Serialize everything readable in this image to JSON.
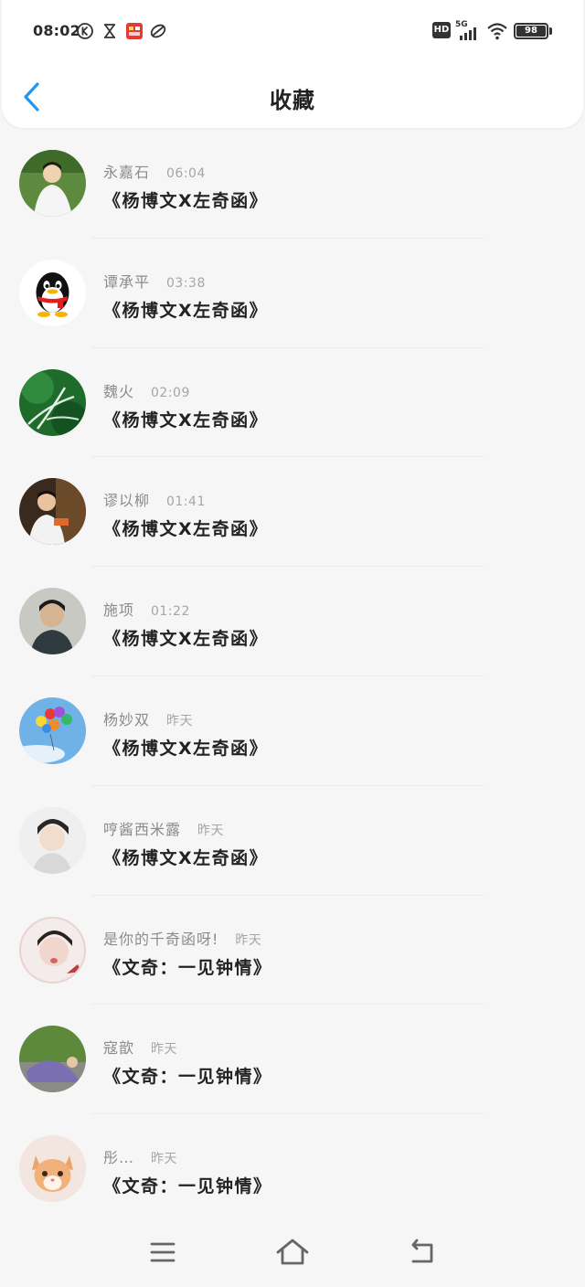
{
  "status_bar": {
    "time": "08:02",
    "left_icons": [
      "k-circle-icon",
      "hourglass-icon",
      "app-badge-icon",
      "leaf-icon"
    ],
    "right_icons": [
      "hd-icon",
      "signal-5g-icon",
      "wifi-icon",
      "battery-icon"
    ],
    "network_label": "5G",
    "hd_label": "HD",
    "battery": "98"
  },
  "header": {
    "title": "收藏"
  },
  "items": [
    {
      "name": "永嘉石",
      "time": "06:04",
      "message": "《杨博文X左奇函》"
    },
    {
      "name": "谭承平",
      "time": "03:38",
      "message": "《杨博文X左奇函》"
    },
    {
      "name": "魏火",
      "time": "02:09",
      "message": "《杨博文X左奇函》"
    },
    {
      "name": "谬以柳",
      "time": "01:41",
      "message": "《杨博文X左奇函》"
    },
    {
      "name": "施项",
      "time": "01:22",
      "message": "《杨博文X左奇函》"
    },
    {
      "name": "杨妙双",
      "time": "昨天",
      "message": "《杨博文X左奇函》"
    },
    {
      "name": "哼酱西米露",
      "time": "昨天",
      "message": "《杨博文X左奇函》"
    },
    {
      "name": "是你的千奇函呀!",
      "time": "昨天",
      "message": "《文奇：一见钟情》"
    },
    {
      "name": "寇歆",
      "time": "昨天",
      "message": "《文奇：一见钟情》"
    },
    {
      "name": "彤…",
      "time": "昨天",
      "message": "《文奇：一见钟情》"
    }
  ],
  "bottom_nav": {
    "icons": [
      "menu-icon",
      "home-icon",
      "back-icon"
    ]
  },
  "colors": {
    "accent": "#2196F3",
    "background": "#f6f6f7"
  }
}
